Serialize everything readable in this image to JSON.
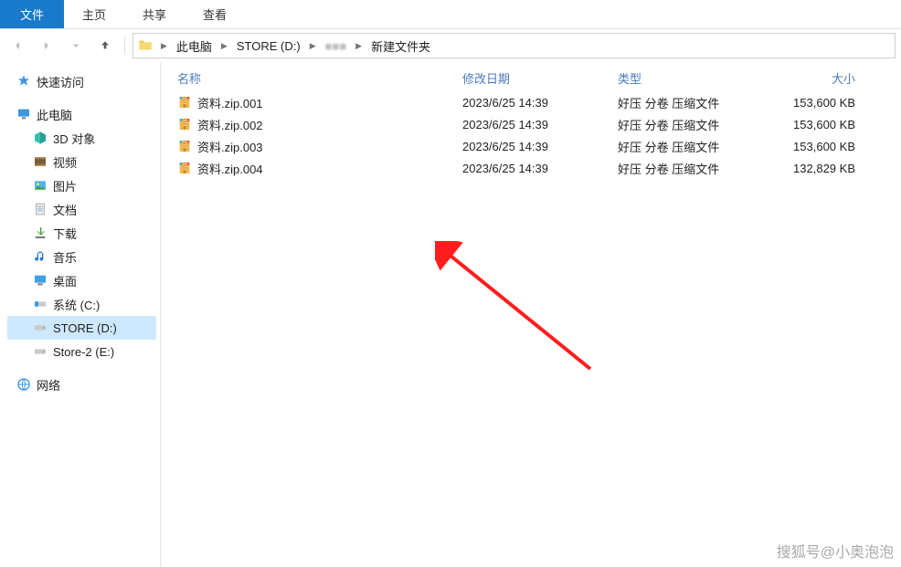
{
  "ribbon": {
    "file": "文件",
    "tabs": [
      "主页",
      "共享",
      "查看"
    ]
  },
  "breadcrumb": {
    "items": [
      "此电脑",
      "STORE (D:)",
      "",
      "新建文件夹"
    ]
  },
  "sidebar": {
    "quick_access": "快速访问",
    "this_pc": "此电脑",
    "children": [
      {
        "label": "3D 对象",
        "icon": "cube"
      },
      {
        "label": "视频",
        "icon": "video"
      },
      {
        "label": "图片",
        "icon": "picture"
      },
      {
        "label": "文档",
        "icon": "doc"
      },
      {
        "label": "下载",
        "icon": "download"
      },
      {
        "label": "音乐",
        "icon": "music"
      },
      {
        "label": "桌面",
        "icon": "desktop"
      },
      {
        "label": "系统 (C:)",
        "icon": "drive-c"
      },
      {
        "label": "STORE (D:)",
        "icon": "drive",
        "selected": true
      },
      {
        "label": "Store-2 (E:)",
        "icon": "drive"
      }
    ],
    "network": "网络"
  },
  "columns": {
    "name": "名称",
    "date": "修改日期",
    "type": "类型",
    "size": "大小"
  },
  "files": [
    {
      "name": "资料.zip.001",
      "date": "2023/6/25 14:39",
      "type": "好压 分卷 压缩文件",
      "size": "153,600 KB"
    },
    {
      "name": "资料.zip.002",
      "date": "2023/6/25 14:39",
      "type": "好压 分卷 压缩文件",
      "size": "153,600 KB"
    },
    {
      "name": "资料.zip.003",
      "date": "2023/6/25 14:39",
      "type": "好压 分卷 压缩文件",
      "size": "153,600 KB"
    },
    {
      "name": "资料.zip.004",
      "date": "2023/6/25 14:39",
      "type": "好压 分卷 压缩文件",
      "size": "132,829 KB"
    }
  ],
  "watermark": "搜狐号@小奥泡泡"
}
